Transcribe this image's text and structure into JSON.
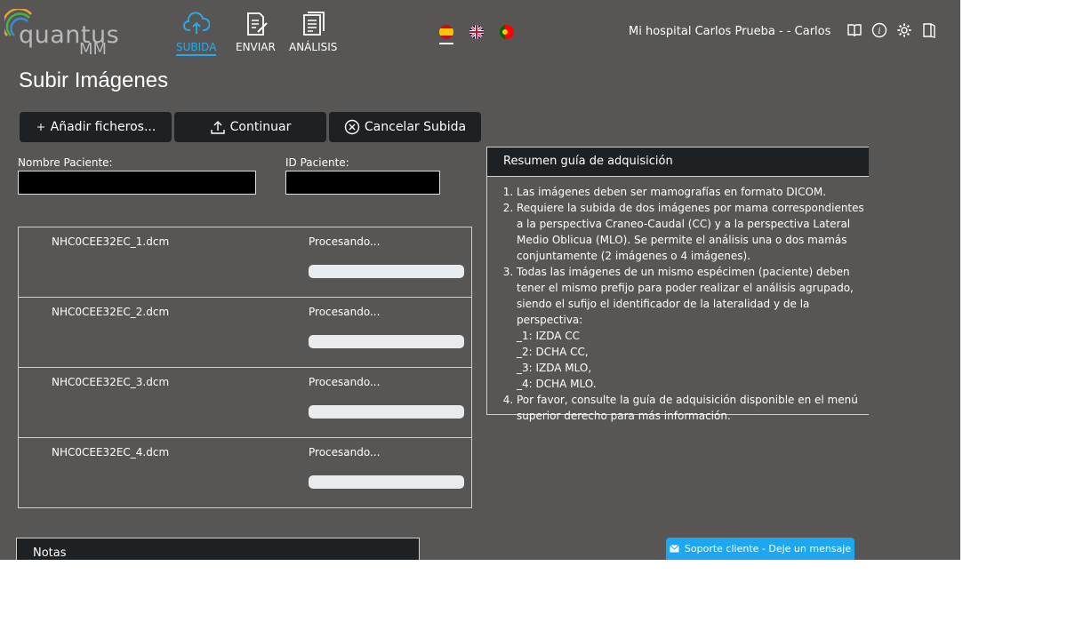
{
  "header": {
    "logo_text": "quantus",
    "logo_sub": "MM",
    "nav": [
      {
        "label": "SUBIDA",
        "icon": "cloud-upload-icon",
        "active": true
      },
      {
        "label": "ENVIAR",
        "icon": "send-document-icon",
        "active": false
      },
      {
        "label": "ANÁLISIS",
        "icon": "analysis-document-icon",
        "active": false
      }
    ],
    "languages": [
      "es-flag",
      "uk-flag",
      "pt-flag"
    ],
    "user": "Mi hospital Carlos Prueba - - Carlos",
    "icons": [
      "book-icon",
      "info-icon",
      "gear-icon",
      "logout-icon"
    ]
  },
  "page": {
    "title": "Subir Imágenes"
  },
  "toolbar": {
    "add_label": "Añadir ficheros...",
    "continue_label": "Continuar",
    "cancel_label": "Cancelar Subida"
  },
  "form": {
    "patient_name_label": "Nombre Paciente:",
    "patient_name_value": "",
    "patient_id_label": "ID Paciente:",
    "patient_id_value": ""
  },
  "files": [
    {
      "name": "NHC0CEE32EC_1.dcm",
      "status": "Procesando...",
      "progress": 0
    },
    {
      "name": "NHC0CEE32EC_2.dcm",
      "status": "Procesando...",
      "progress": 0
    },
    {
      "name": "NHC0CEE32EC_3.dcm",
      "status": "Procesando...",
      "progress": 0
    },
    {
      "name": "NHC0CEE32EC_4.dcm",
      "status": "Procesando...",
      "progress": 0
    }
  ],
  "guide": {
    "title": "Resumen guía de adquisición",
    "items": [
      "Las imágenes deben ser mamografías en formato DICOM.",
      "Requiere la subida de dos imágenes por mama correspondientes a la perspectiva Craneo-Caudal (CC) y a la perspectiva Lateral Medio Oblicua (MLO). Se permite el análisis una o dos mamás conjuntamente (2 imágenes o 4 imágenes).",
      "Todas las imágenes de un mismo espécimen (paciente) deben tener el mismo prefijo para poder realizar el análisis agrupado, siendo el sufijo el identificador de la lateralidad y de la perspectiva:",
      "Por favor, consulte la guía de adquisición disponible en el menú superior derecho para más información."
    ],
    "suffixes": [
      "_1: IZDA CC",
      "_2: DCHA CC,",
      "_3: IZDA MLO,",
      "_4: DCHA MLO."
    ]
  },
  "notes": {
    "title": "Notas"
  },
  "support": {
    "label": "Soporte cliente - Deje un mensaje"
  },
  "colors": {
    "accent": "#29a8e9",
    "background": "#575655",
    "panel": "#1e2124",
    "support": "#1ea7f0"
  }
}
